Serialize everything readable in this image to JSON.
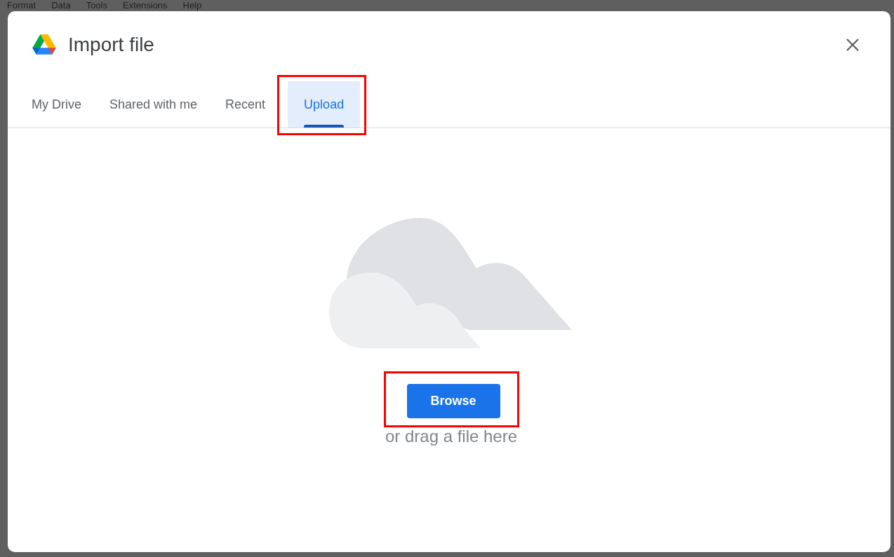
{
  "background_menu": [
    "Format",
    "Data",
    "Tools",
    "Extensions",
    "Help"
  ],
  "dialog": {
    "title": "Import file",
    "tabs": [
      {
        "label": "My Drive",
        "selected": false,
        "highlighted": false
      },
      {
        "label": "Shared with me",
        "selected": false,
        "highlighted": false
      },
      {
        "label": "Recent",
        "selected": false,
        "highlighted": false
      },
      {
        "label": "Upload",
        "selected": true,
        "highlighted": true
      }
    ],
    "upload": {
      "button": {
        "label": "Browse",
        "highlighted": true
      },
      "hint": "or drag a file here"
    }
  }
}
